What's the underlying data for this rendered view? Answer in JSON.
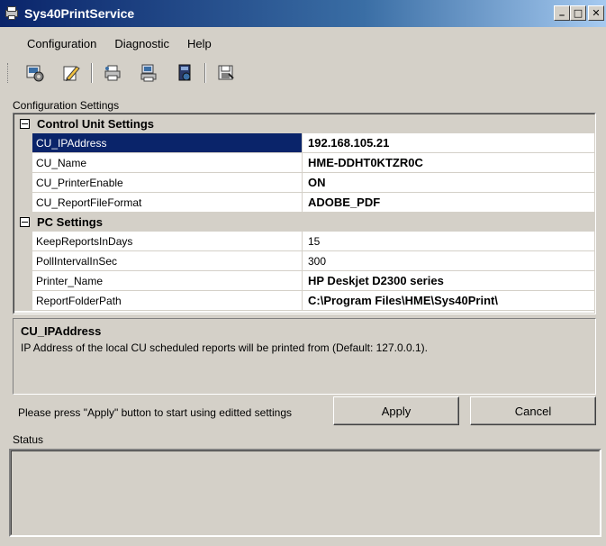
{
  "window": {
    "title": "Sys40PrintService",
    "minimize_glyph": "_",
    "maximize_glyph": "□",
    "close_glyph": "✕"
  },
  "menu": [
    "Configuration",
    "Diagnostic",
    "Help"
  ],
  "toolbar": {
    "icons": [
      "settings-icon",
      "edit-icon",
      "print-icon",
      "network-print-icon",
      "report-icon",
      "save-icon"
    ]
  },
  "config_label": "Configuration Settings",
  "property_grid": {
    "categories": [
      {
        "name": "Control Unit Settings",
        "properties": [
          {
            "name": "CU_IPAddress",
            "value": "192.168.105.21",
            "selected": true,
            "bold": true
          },
          {
            "name": "CU_Name",
            "value": "HME-DDHT0KTZR0C",
            "bold": true
          },
          {
            "name": "CU_PrinterEnable",
            "value": "ON",
            "bold": true
          },
          {
            "name": "CU_ReportFileFormat",
            "value": "ADOBE_PDF",
            "bold": true
          }
        ]
      },
      {
        "name": "PC Settings",
        "properties": [
          {
            "name": "KeepReportsInDays",
            "value": "15",
            "bold": false
          },
          {
            "name": "PollIntervalInSec",
            "value": "300",
            "bold": false
          },
          {
            "name": "Printer_Name",
            "value": "HP Deskjet D2300 series",
            "bold": true
          },
          {
            "name": "ReportFolderPath",
            "value": "C:\\Program Files\\HME\\Sys40Print\\",
            "bold": true
          }
        ]
      }
    ]
  },
  "description": {
    "title": "CU_IPAddress",
    "text": "IP Address of the local CU scheduled reports will be printed from (Default: 127.0.0.1)."
  },
  "apply_hint": "Please press \"Apply\" button to start using editted settings",
  "buttons": {
    "apply": "Apply",
    "cancel": "Cancel"
  },
  "status_label": "Status",
  "status_text": ""
}
